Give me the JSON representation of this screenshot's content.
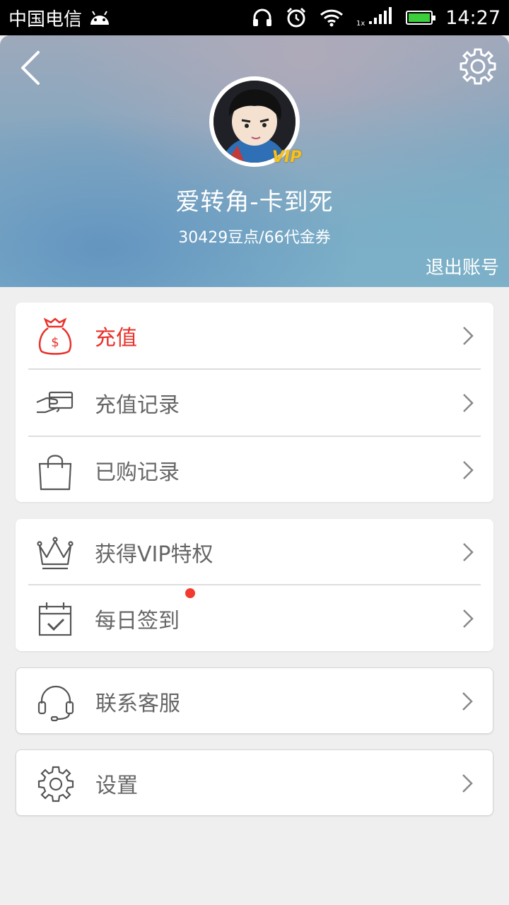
{
  "statusbar": {
    "carrier": "中国电信",
    "time": "14:27"
  },
  "profile": {
    "vip_badge": "VIP",
    "username": "爱转角-卡到死",
    "balance": "30429豆点/66代金券",
    "logout_label": "退出账号"
  },
  "menu_group1": [
    {
      "label": "充值",
      "icon": "money-bag-icon"
    },
    {
      "label": "充值记录",
      "icon": "card-in-hand-icon"
    },
    {
      "label": "已购记录",
      "icon": "shopping-bag-icon"
    }
  ],
  "menu_group2": [
    {
      "label": "获得VIP特权",
      "icon": "crown-icon"
    },
    {
      "label": "每日签到",
      "icon": "calendar-check-icon"
    }
  ],
  "menu_group3": [
    {
      "label": "联系客服",
      "icon": "headset-icon"
    }
  ],
  "menu_group4": [
    {
      "label": "设置",
      "icon": "gear-icon"
    }
  ],
  "colors": {
    "accent_red": "#e8312a",
    "text_gray": "#666666",
    "background": "#efefef"
  }
}
